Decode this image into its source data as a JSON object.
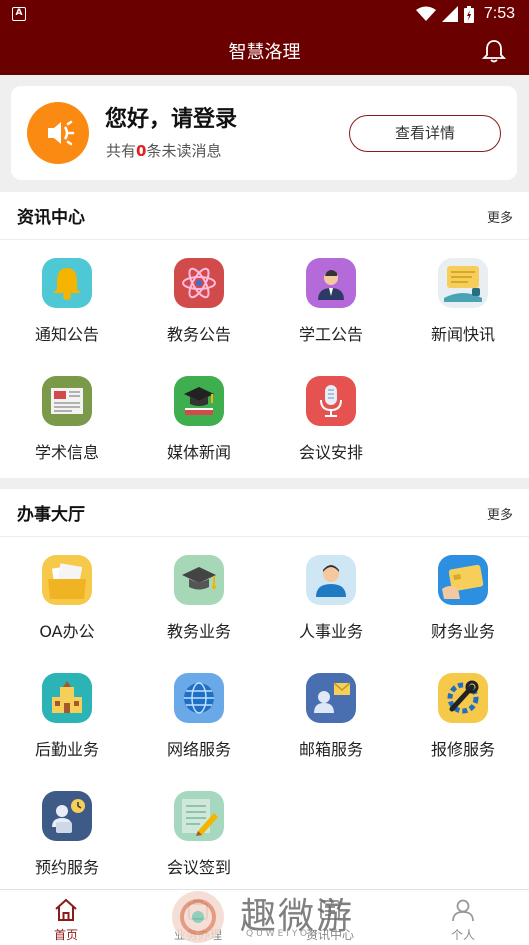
{
  "status_bar": {
    "time": "7:53",
    "app_icon_letter": "A"
  },
  "app_bar": {
    "title": "智慧洛理"
  },
  "login_card": {
    "greeting": "您好，请登录",
    "unread_prefix": "共有",
    "unread_count": "0",
    "unread_suffix": "条未读消息",
    "detail_button": "查看详情"
  },
  "news_section": {
    "title": "资讯中心",
    "more": "更多",
    "items": [
      {
        "label": "通知公告",
        "icon": "bell-icon"
      },
      {
        "label": "教务公告",
        "icon": "atom-icon"
      },
      {
        "label": "学工公告",
        "icon": "person-icon"
      },
      {
        "label": "新闻快讯",
        "icon": "news-chat-icon"
      },
      {
        "label": "学术信息",
        "icon": "newspaper-icon"
      },
      {
        "label": "媒体新闻",
        "icon": "graduation-book-icon"
      },
      {
        "label": "会议安排",
        "icon": "microphone-icon"
      }
    ]
  },
  "service_section": {
    "title": "办事大厅",
    "more": "更多",
    "items": [
      {
        "label": "OA办公",
        "icon": "folder-icon"
      },
      {
        "label": "教务业务",
        "icon": "graduation-cap-icon"
      },
      {
        "label": "人事业务",
        "icon": "user-icon"
      },
      {
        "label": "财务业务",
        "icon": "card-icon"
      },
      {
        "label": "后勤业务",
        "icon": "building-icon"
      },
      {
        "label": "网络服务",
        "icon": "globe-icon"
      },
      {
        "label": "邮箱服务",
        "icon": "mail-icon"
      },
      {
        "label": "报修服务",
        "icon": "wrench-icon"
      },
      {
        "label": "预约服务",
        "icon": "appointment-icon"
      },
      {
        "label": "会议签到",
        "icon": "sign-in-icon"
      }
    ]
  },
  "tab_bar": {
    "tabs": [
      {
        "label": "首页",
        "icon": "home-icon",
        "active": true
      },
      {
        "label": "业务办理",
        "icon": "business-icon",
        "active": false
      },
      {
        "label": "资讯中心",
        "icon": "news-icon",
        "active": false
      },
      {
        "label": "个人",
        "icon": "profile-icon",
        "active": false
      }
    ]
  },
  "watermark": {
    "text": "趣微游",
    "sub": "QUWEIYOU"
  },
  "colors": {
    "brand": "#6b0000",
    "accent_orange": "#fb8a12",
    "unread_red": "#e02020"
  }
}
